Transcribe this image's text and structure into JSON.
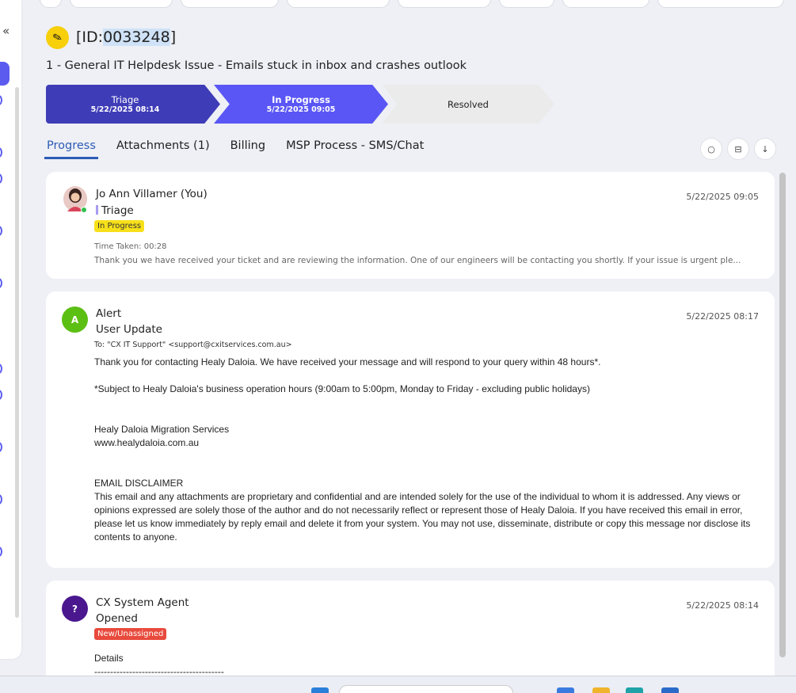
{
  "header": {
    "id_prefix": "[ID:",
    "id_number": "0033248",
    "id_suffix": "]",
    "title": "1 - General IT Helpdesk Issue - Emails stuck in inbox and crashes outlook"
  },
  "stages": [
    {
      "label": "Triage",
      "date": "5/22/2025 08:14"
    },
    {
      "label": "In Progress",
      "date": "5/22/2025 09:05"
    },
    {
      "label": "Resolved",
      "date": ""
    }
  ],
  "tabs": [
    {
      "label": "Progress"
    },
    {
      "label": "Attachments (1)"
    },
    {
      "label": "Billing"
    },
    {
      "label": "MSP Process - SMS/Chat"
    }
  ],
  "sidebar": {
    "collapse_glyph": "«"
  },
  "feed": [
    {
      "author": "Jo Ann Villamer (You)",
      "subtitle": "Triage",
      "badge": "In Progress",
      "time_taken": "Time Taken: 00:28",
      "snippet": "Thank you we have received your ticket and are reviewing the information. One of our engineers will be contacting you shortly. If your issue is urgent ple...",
      "timestamp": "5/22/2025 09:05"
    },
    {
      "avatar_letter": "A",
      "author": "Alert",
      "subtitle": "User Update",
      "to": "To: \"CX IT Support\" <support@cxitservices.com.au>",
      "timestamp": "5/22/2025 08:17",
      "line1": "Thank you for contacting Healy Daloia. We have received your message and will respond to your query within 48 hours*.",
      "line2": "*Subject to Healy Daloia's business operation hours (9:00am to 5:00pm, Monday to Friday - excluding public holidays)",
      "company": "Healy Daloia Migration Services",
      "website": "www.healydaloia.com.au",
      "disclaimer_title": "EMAIL DISCLAIMER",
      "disclaimer": "This email and any attachments are proprietary and confidential and are intended solely for the use of the individual to whom it is addressed. Any views or opinions expressed are solely those of the author and do not necessarily reflect or represent those of Healy Daloia. If you have received this email in error, please let us know immediately by reply email and delete it from your system. You may not use, disseminate, distribute or copy this message nor disclose its contents to anyone."
    },
    {
      "avatar_letter": "?",
      "author": "CX System Agent",
      "subtitle": "Opened",
      "badge": "New/Unassigned",
      "timestamp": "5/22/2025 08:14",
      "details_label": "Details",
      "divider": "-----------------------------------------"
    }
  ],
  "colors": {
    "stage_triage": "#3f3cb8",
    "stage_in_progress": "#5a56f5",
    "stage_resolved": "#ebebeb",
    "badge_in_progress": "#f7e01a",
    "badge_new": "#e84a3c",
    "avatar_alert": "#5cbf14",
    "avatar_agent": "#4a178f",
    "tab_active": "#2d5bb5"
  },
  "icons": [
    "ticket-icon",
    "chat-icon",
    "collapse-icon",
    "download-icon",
    "double-chevron-left-icon"
  ]
}
